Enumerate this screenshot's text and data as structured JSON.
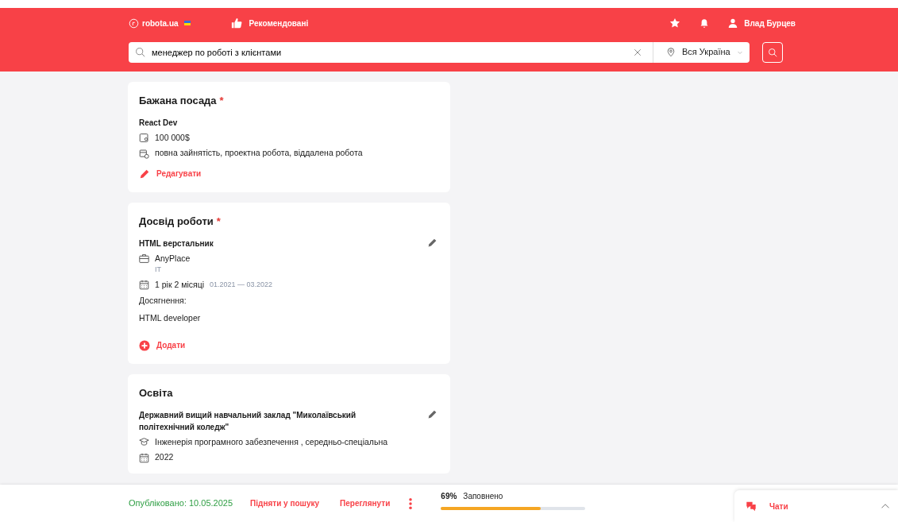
{
  "header": {
    "logo": "robota.ua",
    "recommended": "Рекомендовані",
    "user": "Влад Бурцев",
    "search": {
      "value": "менеджер по роботі з клієнтами"
    },
    "location": "Вся Україна"
  },
  "cards": [
    {
      "kind": "position",
      "title": "Бажана посада",
      "required_mark": "*",
      "name": "React Dev",
      "salary": "100 000$",
      "employment": "повна зайнятість, проектна робота, віддалена робота",
      "action": "Редагувати"
    },
    {
      "kind": "experience",
      "title": "Досвід роботи",
      "required_mark": "*",
      "name": "HTML верстальник",
      "company": "AnyPlace",
      "industry": "IT",
      "duration": "1 рік 2 місяці",
      "period": "01.2021 — 03.2022",
      "achievements_label": "Досягнення:",
      "achievements": "HTML developer",
      "action": "Додати"
    },
    {
      "kind": "education",
      "title": "Освіта",
      "name": "Державний вищий навчальний заклад \"Миколаївський політехнічний коледж\"",
      "specialty": "Інженерія програмного забезпечення , середньо-спеціальна",
      "year": "2022"
    }
  ],
  "footer": {
    "published": "Опубліковано: 10.05.2025",
    "raise": "Підняти у пошуку",
    "view": "Переглянути",
    "percent": "69%",
    "filled": "Заповнено",
    "level": 0.69
  },
  "chat": {
    "label": "Чати"
  }
}
